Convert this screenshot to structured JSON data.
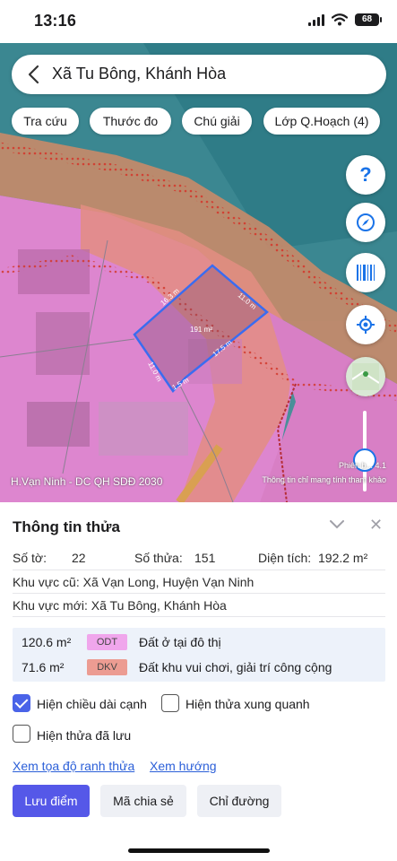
{
  "status_bar": {
    "time": "13:16",
    "battery": "68"
  },
  "search": {
    "title": "Xã Tu Bông, Khánh Hòa"
  },
  "chips": [
    "Tra cứu",
    "Thước đo",
    "Chú giải",
    "Lớp Q.Hoạch (4)"
  ],
  "map": {
    "help_label": "?",
    "parcel_area_label": "191 m²",
    "edge_labels": [
      "16.3 m",
      "11.0 m",
      "17.5 m",
      "1.5 m",
      "11.0 m"
    ],
    "caption": "H.Vạn Ninh - DC QH SDĐ 2030",
    "version": "Phiên b... 4.1",
    "note": "Thông tin chỉ mang tính tham khảo",
    "zone_colors": {
      "residential": "#e58fd9",
      "recreation": "#e2877f",
      "road": "#d8a24a"
    }
  },
  "panel": {
    "title": "Thông tin thửa",
    "so_to_label": "Số tờ:",
    "so_to_value": "22",
    "so_thua_label": "Số thửa:",
    "so_thua_value": "151",
    "dien_tich_label": "Diện tích:",
    "dien_tich_value": "192.2 m²",
    "old_area_label": "Khu vực cũ:",
    "old_area_value": "Xã Vạn Long, Huyện Vạn Ninh",
    "new_area_label": "Khu vực mới:",
    "new_area_value": "Xã Tu Bông, Khánh Hòa",
    "land_use": [
      {
        "area": "120.6 m²",
        "code": "ODT",
        "color": "#f0a6ec",
        "desc": "Đất ở tại đô thị"
      },
      {
        "area": "71.6 m²",
        "code": "DKV",
        "color": "#ec9c92",
        "desc": "Đất khu vui chơi, giải trí công cộng"
      }
    ],
    "checkboxes": {
      "edge_length": {
        "label": "Hiện chiều dài cạnh",
        "checked": true
      },
      "neighbors": {
        "label": "Hiện thửa xung quanh",
        "checked": false
      },
      "saved": {
        "label": "Hiện thửa đã lưu",
        "checked": false
      }
    },
    "links": {
      "coords": "Xem tọa độ ranh thửa",
      "direction": "Xem hướng"
    },
    "buttons": {
      "save": "Lưu điểm",
      "share": "Mã chia sẻ",
      "route": "Chỉ đường"
    }
  }
}
